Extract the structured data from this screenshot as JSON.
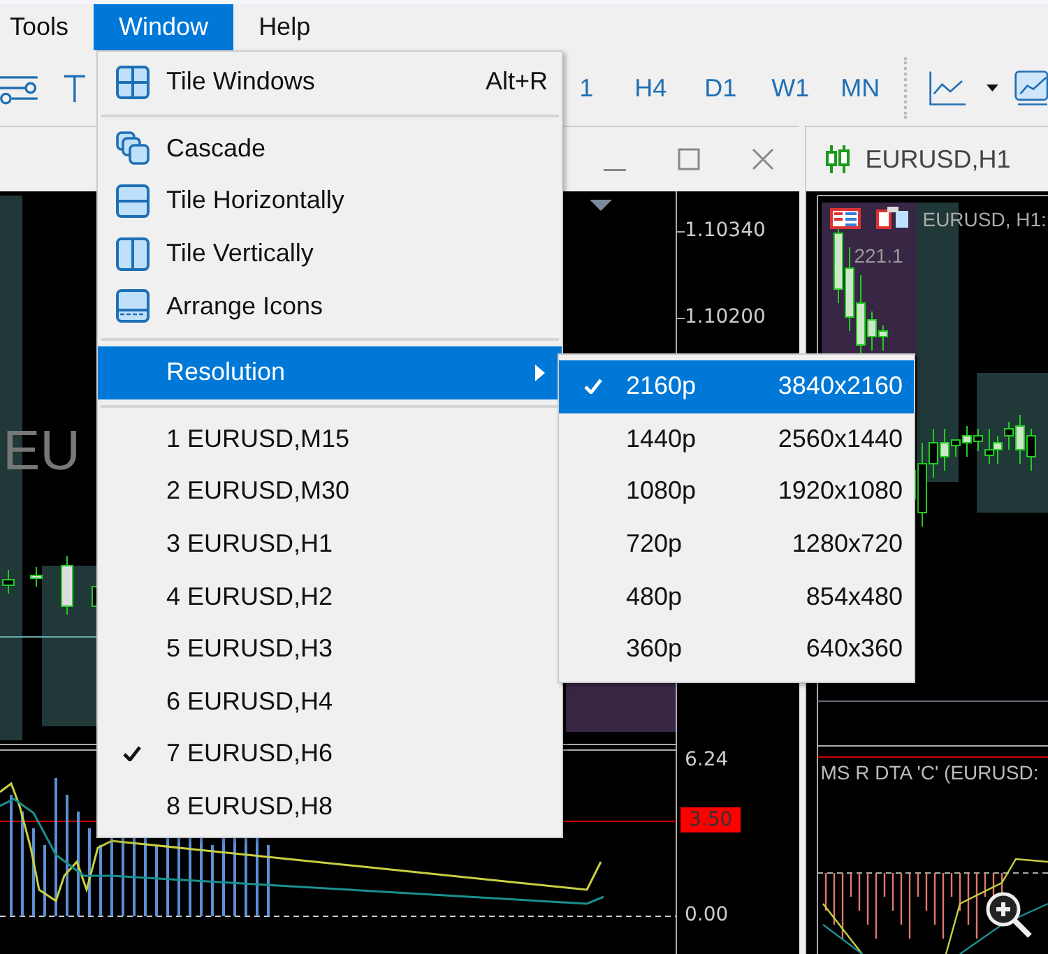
{
  "menubar": [
    {
      "label": "Tools",
      "selected": false
    },
    {
      "label": "Window",
      "selected": true
    },
    {
      "label": "Help",
      "selected": false
    }
  ],
  "toolbar": {
    "timeframes": [
      "1",
      "H4",
      "D1",
      "W1",
      "MN"
    ]
  },
  "left_chart": {
    "price_labels": [
      "1.10340",
      "1.10200"
    ],
    "watermark": [
      "EU"
    ],
    "indicator_labels": [
      {
        "text": "6.24",
        "kind": "plain"
      },
      {
        "text": "3.50",
        "kind": "level"
      },
      {
        "text": "0.00",
        "kind": "plain"
      }
    ]
  },
  "right_chart": {
    "title": "EURUSD,H1",
    "symbol_label": "EURUSD, H1:",
    "value_label": "221.1",
    "indicator_label": "MS R DTA 'C' (EURUSD:"
  },
  "window_menu": {
    "groups": [
      [
        {
          "label": "Tile Windows",
          "shortcut": "Alt+R",
          "kind": "command"
        }
      ],
      [
        {
          "label": "Cascade",
          "kind": "command"
        },
        {
          "label": "Tile Horizontally",
          "kind": "command"
        },
        {
          "label": "Tile Vertically",
          "kind": "command"
        },
        {
          "label": "Arrange Icons",
          "kind": "command"
        }
      ],
      [
        {
          "label": "Resolution",
          "kind": "submenu",
          "selected": true
        }
      ],
      [
        {
          "label": "1 EURUSD,M15",
          "kind": "window",
          "checked": false
        },
        {
          "label": "2 EURUSD,M30",
          "kind": "window",
          "checked": false
        },
        {
          "label": "3 EURUSD,H1",
          "kind": "window",
          "checked": false
        },
        {
          "label": "4 EURUSD,H2",
          "kind": "window",
          "checked": false
        },
        {
          "label": "5 EURUSD,H3",
          "kind": "window",
          "checked": false
        },
        {
          "label": "6 EURUSD,H4",
          "kind": "window",
          "checked": false
        },
        {
          "label": "7 EURUSD,H6",
          "kind": "window",
          "checked": true
        },
        {
          "label": "8 EURUSD,H8",
          "kind": "window",
          "checked": false
        }
      ]
    ]
  },
  "resolution_menu": [
    {
      "name": "2160p",
      "size": "3840x2160",
      "checked": true,
      "selected": true
    },
    {
      "name": "1440p",
      "size": "2560x1440",
      "checked": false,
      "selected": false
    },
    {
      "name": "1080p",
      "size": "1920x1080",
      "checked": false,
      "selected": false
    },
    {
      "name": "720p",
      "size": "1280x720",
      "checked": false,
      "selected": false
    },
    {
      "name": "480p",
      "size": "854x480",
      "checked": false,
      "selected": false
    },
    {
      "name": "360p",
      "size": "640x360",
      "checked": false,
      "selected": false
    }
  ]
}
